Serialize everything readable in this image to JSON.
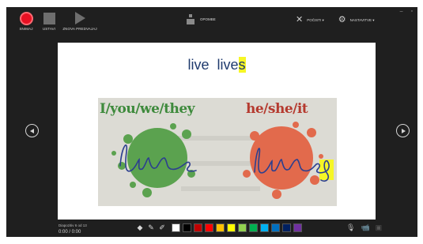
{
  "toolbar": {
    "record_label": "SNIMAJ",
    "stop_label": "USTAVI",
    "replay_label": "ZNOVA PREDVAJAJ",
    "options_label": "OPOMBE",
    "clear_label": "POČISTI ▾",
    "settings_label": "NASTAVITVE ▾",
    "minimize": "–",
    "restore": "▫"
  },
  "slide": {
    "title_word1": "live",
    "title_word2_stem": "live",
    "title_word2_suffix": "s",
    "photo_label_left": "I/you/we/they",
    "photo_label_right": "he/she/it",
    "handwriting_left": "live",
    "handwriting_right": "lives"
  },
  "footer": {
    "slide_counter": "Diapozitiv 6 od 13",
    "time": "0:00 / 0:00"
  },
  "ink_colors": [
    "#ffffff",
    "#000000",
    "#c00000",
    "#ff0000",
    "#ffc000",
    "#ffff00",
    "#92d050",
    "#00b050",
    "#00b0f0",
    "#0070c0",
    "#002060",
    "#7030a0"
  ],
  "icons": {
    "record": "record-icon",
    "stop": "stop-icon",
    "replay": "play-icon",
    "options": "notes-icon",
    "clear": "close-icon",
    "settings": "settings-icon",
    "eraser": "eraser-icon",
    "pen": "pen-icon",
    "highlighter": "highlighter-icon",
    "mic": "microphone-icon",
    "camera": "camera-icon",
    "camera_preview": "camera-preview-icon",
    "prev": "previous-slide-icon",
    "next": "next-slide-icon"
  }
}
